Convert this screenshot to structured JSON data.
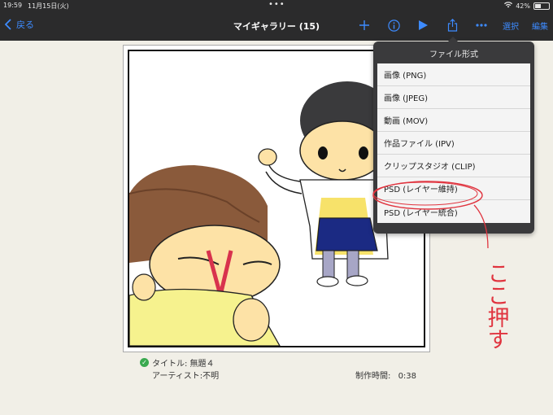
{
  "status": {
    "time": "19:59",
    "date": "11月15日(火)",
    "battery": "42%",
    "battery_level": 0.42
  },
  "nav": {
    "back_label": "戻る",
    "title": "マイギャラリー (15)",
    "select_label": "選択",
    "edit_label": "編集",
    "icons": [
      "plus-icon",
      "info-icon",
      "play-icon",
      "share-icon",
      "more-icon"
    ]
  },
  "popover": {
    "title": "ファイル形式",
    "items": [
      "画像 (PNG)",
      "画像 (JPEG)",
      "動画 (MOV)",
      "作品ファイル (IPV)",
      "クリップスタジオ (CLIP)",
      "PSD (レイヤー維持)",
      "PSD (レイヤー統合)"
    ]
  },
  "artwork": {
    "title_line": "タイトル: 無題４",
    "artist_line": "アーティスト:不明",
    "time_label": "制作時間:",
    "time_value": "0:38"
  },
  "annotation": {
    "text": "ここ押す",
    "color": "#e0343f"
  }
}
